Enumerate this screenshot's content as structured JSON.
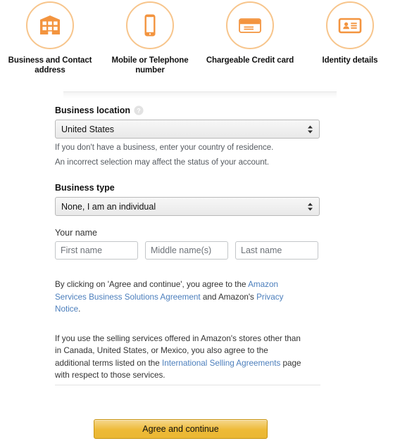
{
  "steps": [
    {
      "icon": "building-icon",
      "label": "Business and Contact address"
    },
    {
      "icon": "mobile-phone-icon",
      "label": "Mobile or Telephone number"
    },
    {
      "icon": "credit-card-icon",
      "label": "Chargeable Credit card"
    },
    {
      "icon": "id-card-icon",
      "label": "Identity details"
    }
  ],
  "form": {
    "business_location": {
      "label": "Business location",
      "help_icon": "help-circle-icon",
      "selected": "United States",
      "hint_line1": "If you don't have a business, enter your country of residence.",
      "hint_line2": "An incorrect selection may affect the status of your account."
    },
    "business_type": {
      "label": "Business type",
      "selected": "None, I am an individual"
    },
    "your_name": {
      "label": "Your name",
      "first_placeholder": "First name",
      "first_value": "",
      "middle_placeholder": "Middle name(s)",
      "middle_value": "",
      "last_placeholder": "Last name",
      "last_value": ""
    }
  },
  "legal": {
    "p1_part1": "By clicking on 'Agree and continue', you agree to the ",
    "p1_link1": "Amazon Services Business Solutions Agreement",
    "p1_part2": " and Amazon's ",
    "p1_link2": "Privacy Notice",
    "p1_part3": ".",
    "p2_part1": "If you use the selling services offered in Amazon's stores other than in Canada, United States, or Mexico, you also agree to the additional terms listed on the ",
    "p2_link1": "International Selling Agreements",
    "p2_part2": " page with respect to those services."
  },
  "actions": {
    "agree_label": "Agree and continue"
  },
  "colors": {
    "accent_orange": "#f3943f",
    "ring_orange": "#f7c58c",
    "link_blue": "#4b7ebc",
    "button_gold": "#eeba37"
  }
}
